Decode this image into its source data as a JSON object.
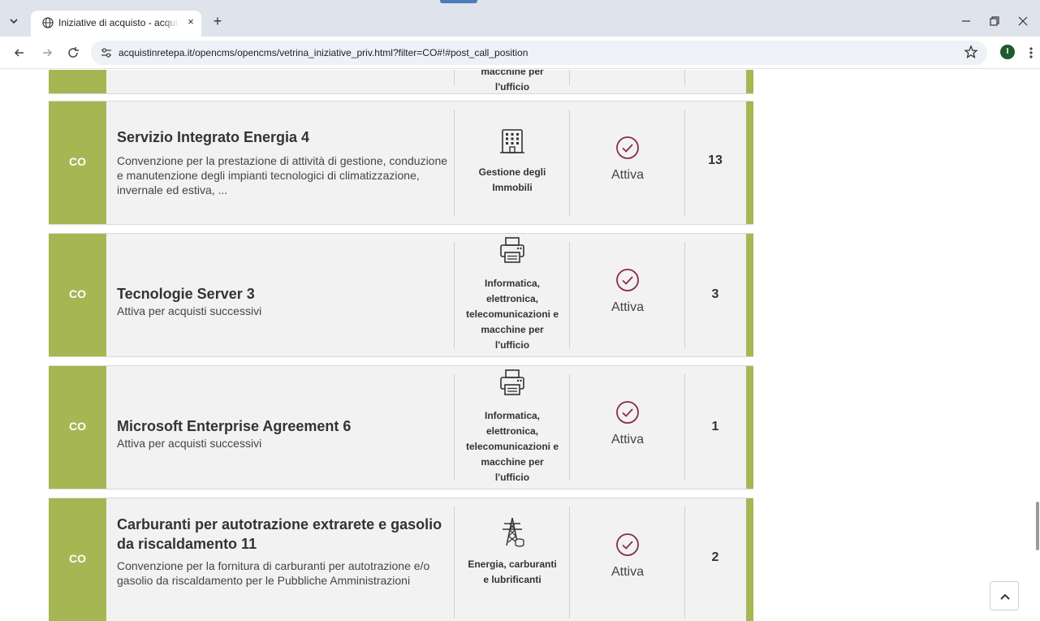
{
  "browser": {
    "tab_title": "Iniziative di acquisto - acquistinretepa",
    "tab_close": "×",
    "new_tab": "+",
    "url_host": "acquistinretepa.it",
    "url_path": "/opencms/opencms/vetrina_iniziative_priv.html?filter=CO#!#post_call_position",
    "avatar_letter": "I",
    "icons": [
      "tab-list-icon",
      "globe-icon",
      "back-arrow-icon",
      "forward-arrow-icon",
      "reload-icon",
      "site-settings-icon",
      "bookmark-star-icon",
      "kebab-menu-icon",
      "minimize-icon",
      "restore-icon",
      "close-window-icon"
    ]
  },
  "partial_card": {
    "category_lines": [
      "macchine per",
      "l'ufficio"
    ]
  },
  "cards": [
    {
      "code": "CO",
      "title": "Servizio Integrato Energia 4",
      "description": "Convenzione per la prestazione di attività di gestione, conduzione e manutenzione degli impianti tecnologici di climatizzazione, invernale ed estiva, ...",
      "category_lines": [
        "Gestione degli",
        "Immobili"
      ],
      "category_icon": "building-icon",
      "status": "Attiva",
      "count": "13"
    },
    {
      "code": "CO",
      "title": "Tecnologie Server 3",
      "description": "Attiva per acquisti successivi",
      "category_lines": [
        "Informatica,",
        "elettronica,",
        "telecomunicazioni e",
        "macchine per",
        "l'ufficio"
      ],
      "category_icon": "printer-icon",
      "status": "Attiva",
      "count": "3"
    },
    {
      "code": "CO",
      "title": "Microsoft Enterprise Agreement 6",
      "description": "Attiva per acquisti successivi",
      "category_lines": [
        "Informatica,",
        "elettronica,",
        "telecomunicazioni e",
        "macchine per",
        "l'ufficio"
      ],
      "category_icon": "printer-icon",
      "status": "Attiva",
      "count": "1"
    },
    {
      "code": "CO",
      "title": "Carburanti per autotrazione extrarete e gasolio da riscaldamento 11",
      "description": "Convenzione per la fornitura di carburanti per autotrazione e/o gasolio da riscaldamento per le Pubbliche Amministrazioni",
      "category_lines": [
        "Energia, carburanti",
        "e lubrificanti"
      ],
      "category_icon": "power-pylon-icon",
      "status": "Attiva",
      "count": "2"
    }
  ],
  "colors": {
    "accent_green": "#a6b653",
    "status_purple": "#8a2a4a",
    "card_bg": "#f2f2f2"
  }
}
